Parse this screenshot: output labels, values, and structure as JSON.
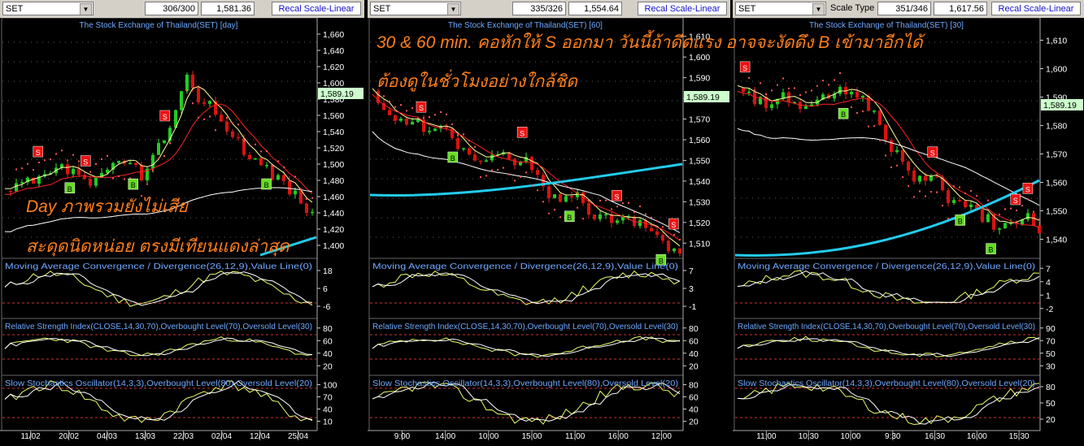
{
  "colors": {
    "title": "#6fa8ff",
    "axis": "#ffffff",
    "grid_dot": "#606060",
    "signal_s": "#ee1111",
    "signal_b": "#66dd22",
    "annotation": "#ff7f1a",
    "cyan_ma": "#22ccee",
    "price_badge": "#ccffcc"
  },
  "annotations": {
    "p1_line1": "Day ภาพรวมยังไม่เสีย",
    "p1_line2": "สะดุดนิดหน่อย ตรงมีเทียนแดงล่าสุด",
    "p2_line1": "30 & 60 min. คอหักให้ S ออกมา วันนี้ถ้าดีดแรง อาจจะงัดดึง B เข้ามาอีกได้",
    "p2_line2": "ต้องดูในชั่วโมงอย่างใกล้ชิด"
  },
  "panels": [
    {
      "symbol": "SET",
      "scale_label": "",
      "bars": "306/300",
      "last": "1,581.36",
      "recal": "Recal Scale-Linear",
      "title": "The Stock Exchange of Thailand(SET) [day]",
      "price_ticks": [
        "1,660",
        "1,640",
        "1,620",
        "1,600",
        "1,580",
        "1,560",
        "1,540",
        "1,520",
        "1,500",
        "1,480",
        "1,460",
        "1,440",
        "1,420",
        "1,400"
      ],
      "price_badge": "1,589.19",
      "macd_title": "Moving Average Convergence / Divergence(26,12,9),Value Line(0)",
      "macd_ticks": [
        "18",
        "6",
        "-6"
      ],
      "rsi_title": "Relative Strength Index(CLOSE,14,30,70),Overbought Level(70),Oversold Level(30)",
      "rsi_ticks": [
        "80",
        "60",
        "40",
        "20"
      ],
      "sto_title": "Slow Stochastics Oscillator(14,3,3),Overbought Level(80),Oversold Level(20)",
      "sto_ticks": [
        "100",
        "70",
        "40",
        "10"
      ],
      "dates": [
        "11/02",
        "20/02",
        "04/03",
        "13/03",
        "22/03",
        "02/04",
        "12/04",
        "25/04"
      ]
    },
    {
      "symbol": "SET",
      "scale_label": "",
      "bars": "335/326",
      "last": "1,554.64",
      "recal": "Recal Scale-Linear",
      "title": "The Stock Exchange of Thailand(SET) [60]",
      "price_ticks": [
        "1,610",
        "1,600",
        "1,590",
        "1,580",
        "1,570",
        "1,560",
        "1,550",
        "1,540",
        "1,530",
        "1,520",
        "1,510"
      ],
      "price_badge": "1,589.19",
      "macd_title": "Moving Average Convergence / Divergence(26,12,9),Value Line(0)",
      "macd_ticks": [
        "7",
        "3",
        "-1"
      ],
      "rsi_title": "Relative Strength Index(CLOSE,14,30,70),Overbought Level(70),Oversold Level(30)",
      "rsi_ticks": [
        "80",
        "60",
        "40",
        "20"
      ],
      "sto_title": "Slow Stochastics Oscillator(14,3,3),Overbought Level(80),Oversold Level(20)",
      "sto_ticks": [
        "80",
        "60",
        "40",
        "20"
      ],
      "dates": [
        "9:00",
        "14:00",
        "10:00",
        "15:00",
        "11:00",
        "16:00",
        "12:00"
      ]
    },
    {
      "symbol": "SET",
      "scale_label": "Scale Type",
      "bars": "351/346",
      "last": "1,617.56",
      "recal": "Recal Scale-Linear",
      "title": "The Stock Exchange of Thailand(SET) [30]",
      "price_ticks": [
        "1,610",
        "1,600",
        "1,590",
        "1,580",
        "1,570",
        "1,560",
        "1,550",
        "1,540"
      ],
      "price_badge": "1,589.19",
      "macd_title": "Moving Average Convergence / Divergence(26,12,9),Value Line(0)",
      "macd_ticks": [
        "7",
        "4",
        "1",
        "-2"
      ],
      "rsi_title": "Relative Strength Index(CLOSE,14,30,70),Overbought Level(70),Oversold Level(30)",
      "rsi_ticks": [
        "90",
        "70",
        "50",
        "30"
      ],
      "sto_title": "Slow Stochastics Oscillator(14,3,3),Overbought Level(80),Oversold Level(20)",
      "sto_ticks": [
        "80",
        "50",
        "20"
      ],
      "dates": [
        "11:00",
        "10:30",
        "10:00",
        "9:30",
        "16:30",
        "16:00",
        "15:30"
      ]
    }
  ]
}
